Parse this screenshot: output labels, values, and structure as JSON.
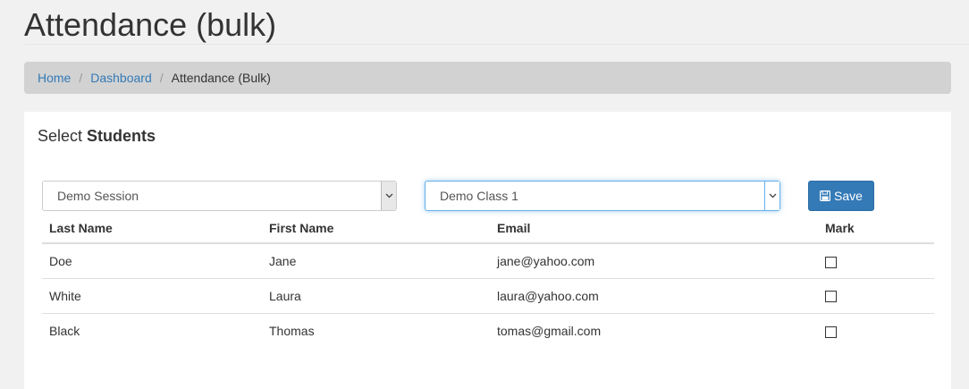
{
  "page": {
    "title": "Attendance (bulk)"
  },
  "breadcrumb": {
    "items": [
      {
        "label": "Home"
      },
      {
        "label": "Dashboard"
      }
    ],
    "current": "Attendance (Bulk)",
    "separator": "/"
  },
  "panel": {
    "heading_prefix": "Select",
    "heading_bold": "Students"
  },
  "filters": {
    "session_selected": "Demo Session",
    "class_selected": "Demo Class 1",
    "save_label": "Save",
    "dropdown_icon": "chevron-down-icon",
    "save_icon": "floppy-disk-icon"
  },
  "table": {
    "headers": {
      "last_name": "Last Name",
      "first_name": "First Name",
      "email": "Email",
      "mark": "Mark"
    },
    "rows": [
      {
        "last_name": "Doe",
        "first_name": "Jane",
        "email": "jane@yahoo.com",
        "mark": false
      },
      {
        "last_name": "White",
        "first_name": "Laura",
        "email": "laura@yahoo.com",
        "mark": false
      },
      {
        "last_name": "Black",
        "first_name": "Thomas",
        "email": "tomas@gmail.com",
        "mark": false
      }
    ]
  },
  "colors": {
    "link": "#337ab7",
    "primary_button": "#337ab7",
    "breadcrumb_bg": "#d2d2d2",
    "page_bg": "#f1f1f1",
    "focus_border": "#66afe9"
  }
}
